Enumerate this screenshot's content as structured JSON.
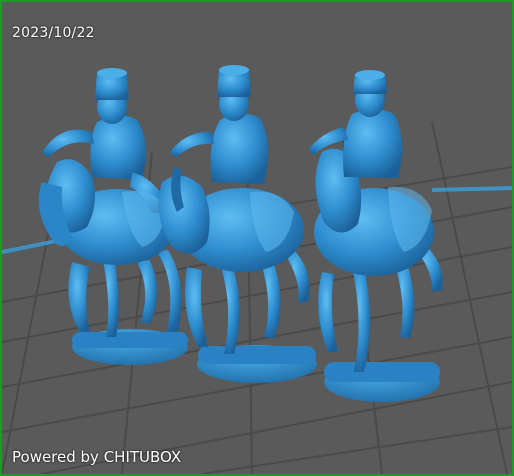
{
  "viewer": {
    "date_stamp": "2023/10/22",
    "brand_text": "Powered by CHITUBOX"
  },
  "colors": {
    "background": "#5a5a5a",
    "grid": "#4b4b4b",
    "model": "#2f8fd0",
    "model_highlight": "#55b6ee",
    "model_shadow": "#1e6aa4",
    "platform_axis": "#3aa0e0",
    "frame": "#1f9a2a"
  },
  "scene": {
    "figures": [
      {
        "label": "cavalry-miniature-left"
      },
      {
        "label": "cavalry-miniature-center"
      },
      {
        "label": "cavalry-miniature-right"
      }
    ]
  }
}
